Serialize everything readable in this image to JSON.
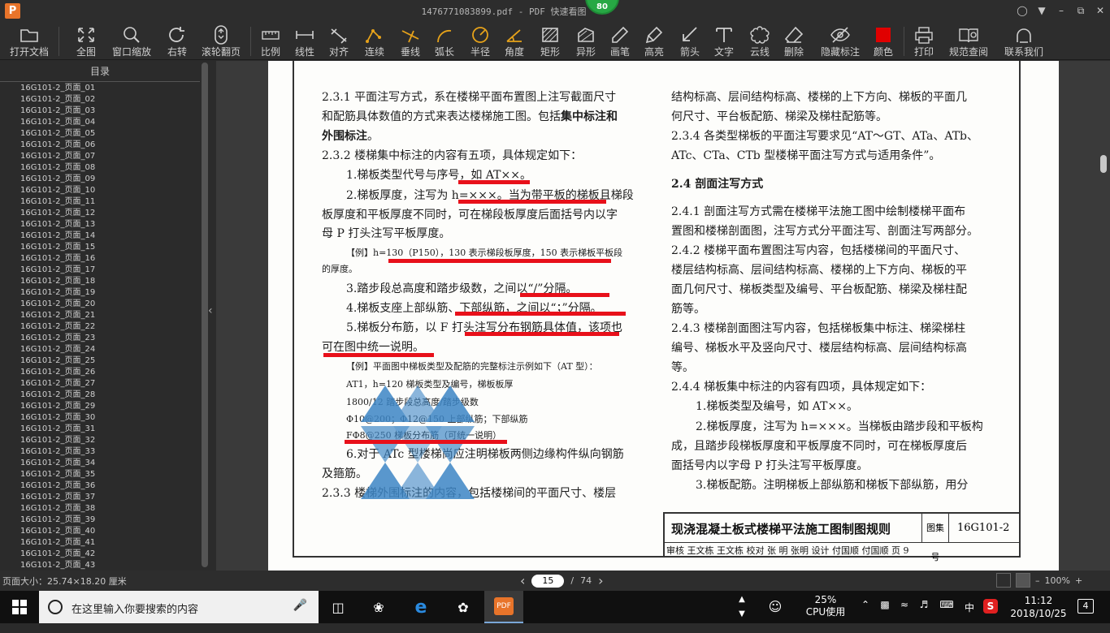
{
  "app": {
    "logo": "P",
    "title": "1476771083899.pdf - PDF 快速看图",
    "badge": "80"
  },
  "toolbar": {
    "open": "打开文档",
    "fit": "全图",
    "window_zoom": "窗口缩放",
    "rotate": "右转",
    "wheel_page": "滚轮翻页",
    "scale": "比例",
    "linear": "线性",
    "align": "对齐",
    "continuous": "连续",
    "perpendicular": "垂线",
    "arc_length": "弧长",
    "radius": "半径",
    "angle": "角度",
    "rectangle": "矩形",
    "irregular": "异形",
    "pen": "画笔",
    "highlight": "高亮",
    "arrow": "箭头",
    "text": "文字",
    "cloud": "云线",
    "delete": "删除",
    "hide_marks": "隐藏标注",
    "color": "颜色",
    "print": "打印",
    "standards": "规范查阅",
    "contact": "联系我们",
    "color_value": "#e00000"
  },
  "sidebar": {
    "header": "目录",
    "items": [
      "16G101-2_页面_01",
      "16G101-2_页面_02",
      "16G101-2_页面_03",
      "16G101-2_页面_04",
      "16G101-2_页面_05",
      "16G101-2_页面_06",
      "16G101-2_页面_07",
      "16G101-2_页面_08",
      "16G101-2_页面_09",
      "16G101-2_页面_10",
      "16G101-2_页面_11",
      "16G101-2_页面_12",
      "16G101-2_页面_13",
      "16G101-2_页面_14",
      "16G101-2_页面_15",
      "16G101-2_页面_16",
      "16G101-2_页面_17",
      "16G101-2_页面_18",
      "16G101-2_页面_19",
      "16G101-2_页面_20",
      "16G101-2_页面_21",
      "16G101-2_页面_22",
      "16G101-2_页面_23",
      "16G101-2_页面_24",
      "16G101-2_页面_25",
      "16G101-2_页面_26",
      "16G101-2_页面_27",
      "16G101-2_页面_28",
      "16G101-2_页面_29",
      "16G101-2_页面_30",
      "16G101-2_页面_31",
      "16G101-2_页面_32",
      "16G101-2_页面_33",
      "16G101-2_页面_34",
      "16G101-2_页面_35",
      "16G101-2_页面_36",
      "16G101-2_页面_37",
      "16G101-2_页面_38",
      "16G101-2_页面_39",
      "16G101-2_页面_40",
      "16G101-2_页面_41",
      "16G101-2_页面_42",
      "16G101-2_页面_43"
    ]
  },
  "document": {
    "left": {
      "l1": "2.3.1 平面注写方式，系在楼梯平面布置图上注写截面尺寸",
      "l2a": "和配筋具体数值的方式来表达楼梯施工图。包括",
      "l2b": "集中标注和",
      "l3": "外围标注",
      "l3b": "。",
      "l4": "2.3.2 楼梯集中标注的内容有五项，具体规定如下：",
      "l5": "1.梯板类型代号与序号，如 AT××。",
      "l6": "2.梯板厚度，注写为 h=×××。当为带平板的梯板且梯段",
      "l7": "板厚度和平板厚度不同时，可在梯段板厚度后面括号内以字",
      "l8": "母 P 打头注写平板厚度。",
      "l9": "【例】h=130（P150），130 表示梯段板厚度，150 表示梯板平板段",
      "l10": "的厚度。",
      "l11": "3.踏步段总高度和踏步级数，之间以“/”分隔。",
      "l12": "4.梯板支座上部纵筋、下部纵筋，之间以“；”分隔。",
      "l13": "5.梯板分布筋，以 F 打头注写分布钢筋具体值，该项也",
      "l14": "可在图中统一说明。",
      "l15": "【例】平面图中梯板类型及配筋的完整标注示例如下（AT 型）：",
      "l16": "AT1，h=120   梯板类型及编号，梯板板厚",
      "l17": "1800/12   踏步段总高度/踏步级数",
      "l18": "Φ10@200；Φ12@150   上部纵筋；下部纵筋",
      "l19": "FΦ8@250   梯板分布筋（可统一说明）",
      "l20": "6.对于 ATc 型楼梯尚应注明梯板两侧边缘构件纵向钢筋",
      "l21": "及箍筋。",
      "l22": "2.3.3 楼梯外围标注的内容，包括楼梯间的平面尺寸、楼层"
    },
    "right": {
      "r1": "结构标高、层间结构标高、楼梯的上下方向、梯板的平面几",
      "r2": "何尺寸、平台板配筋、梯梁及梯柱配筋等。",
      "r3": "2.3.4 各类型梯板的平面注写要求见“AT～GT、ATa、ATb、",
      "r4": "ATc、CTa、CTb 型楼梯平面注写方式与适用条件”。",
      "r5": "2.4 剖面注写方式",
      "r6": "2.4.1 剖面注写方式需在楼梯平法施工图中绘制楼梯平面布",
      "r7": "置图和楼梯剖面图，注写方式分平面注写、剖面注写两部分。",
      "r8": "2.4.2 楼梯平面布置图注写内容，包括楼梯间的平面尺寸、",
      "r9": "楼层结构标高、层间结构标高、楼梯的上下方向、梯板的平",
      "r10": "面几何尺寸、梯板类型及编号、平台板配筋、梯梁及梯柱配",
      "r11": "筋等。",
      "r12": "2.4.3 楼梯剖面图注写内容，包括梯板集中标注、梯梁梯柱",
      "r13": "编号、梯板水平及竖向尺寸、楼层结构标高、层间结构标高",
      "r14": "等。",
      "r15": "2.4.4 梯板集中标注的内容有四项，具体规定如下：",
      "r16": "1.梯板类型及编号，如 AT××。",
      "r17": "2.梯板厚度，注写为 h=×××。当梯板由踏步段和平板构",
      "r18": "成，且踏步段梯板厚度和平板厚度不同时，可在梯板厚度后",
      "r19": "面括号内以字母 P 打头注写平板厚度。",
      "r20": "3.梯板配筋。注明梯板上部纵筋和梯板下部纵筋，用分"
    },
    "titleblock": {
      "title": "现浇混凝土板式楼梯平法施工图制图规则",
      "set_label": "图集号",
      "set_no": "16G101-2",
      "row2": "审核 王文栋  王文栋  校对 张   明  张明  设计 付国顺  付国顺  页      9"
    }
  },
  "status": {
    "page_size": "页面大小：25.74×18.20 厘米",
    "current_page": "15",
    "separator": "/",
    "total_pages": "74",
    "zoom": "100%",
    "prev": "‹",
    "next": "›"
  },
  "taskbar": {
    "search_placeholder": "在这里输入你要搜索的内容",
    "cpu_percent": "25%",
    "cpu_label": "CPU使用",
    "ime": "中",
    "time": "11:12",
    "date": "2018/10/25",
    "notifications": "4"
  }
}
